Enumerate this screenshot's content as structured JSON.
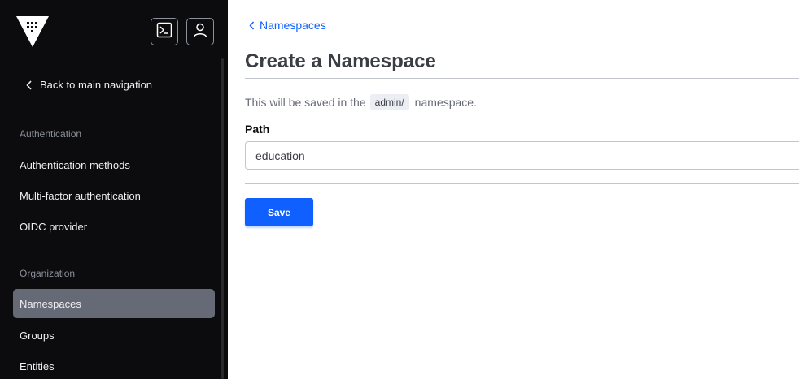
{
  "sidebar": {
    "back_label": "Back to main navigation",
    "sections": [
      {
        "title": "Authentication",
        "items": [
          {
            "label": "Authentication methods"
          },
          {
            "label": "Multi-factor authentication"
          },
          {
            "label": "OIDC provider"
          }
        ]
      },
      {
        "title": "Organization",
        "items": [
          {
            "label": "Namespaces",
            "active": true
          },
          {
            "label": "Groups"
          },
          {
            "label": "Entities"
          }
        ]
      }
    ],
    "header_icons": [
      "vault-logo-icon",
      "terminal-icon",
      "user-icon"
    ]
  },
  "main": {
    "breadcrumb": "Namespaces",
    "title": "Create a Namespace",
    "description_prefix": "This will be saved in the",
    "namespace_chip": "admin/",
    "description_suffix": "namespace.",
    "path_label": "Path",
    "path_value": "education",
    "save_label": "Save"
  },
  "colors": {
    "sidebar_bg": "#0c0c0e",
    "active_item_bg": "#656a76",
    "accent": "#1060ff"
  }
}
